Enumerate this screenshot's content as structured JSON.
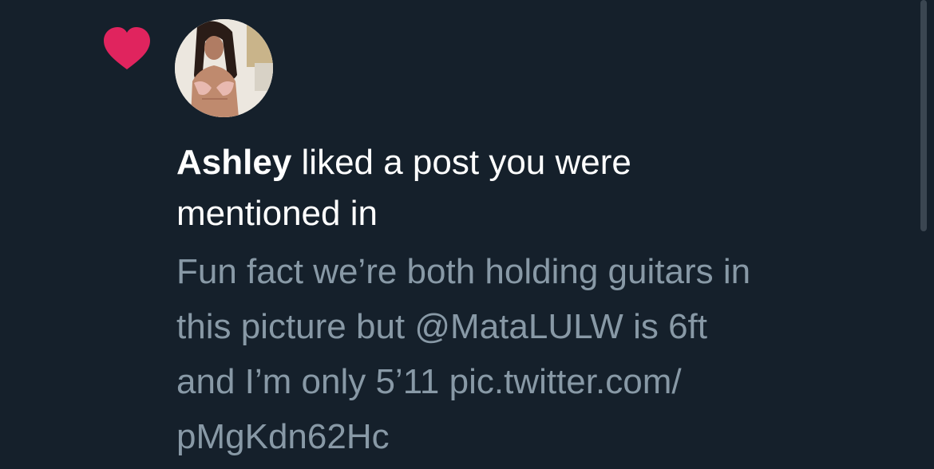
{
  "notification": {
    "actor": "Ashley",
    "action_line1": " liked a post you were",
    "action_line2": "mentioned in",
    "tweet_lines": [
      "Fun fact we’re both holding guitars in",
      "this picture but @MataLULW is 6ft",
      "and I’m only 5’11 pic.twitter.com/",
      "pMgKdn62Hc"
    ]
  },
  "icons": {
    "notification_type": "heart-icon",
    "heart_color": "#e0245e"
  },
  "colors": {
    "background": "#15202b",
    "primary_text": "#ffffff",
    "secondary_text": "#8899a6"
  }
}
